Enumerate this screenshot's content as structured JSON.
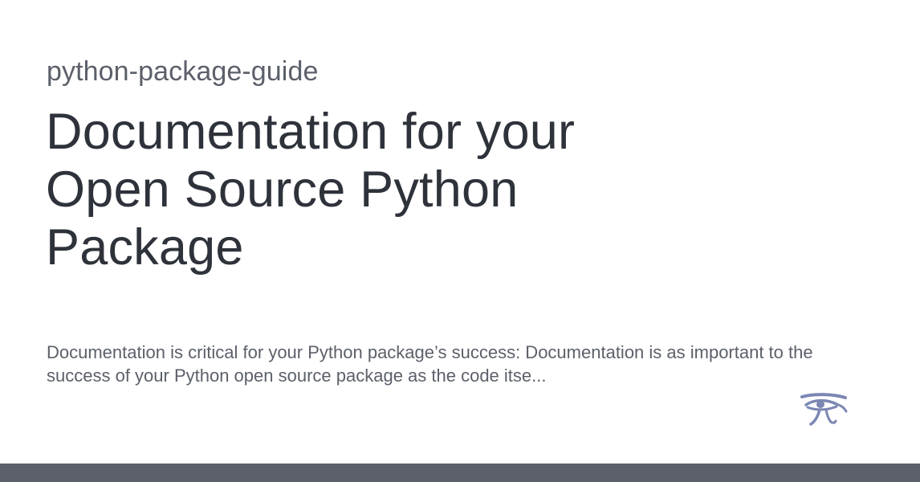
{
  "card": {
    "site_name": "python-package-guide",
    "title": "Documentation for your Open Source Python Package",
    "description": "Documentation is critical for your Python package’s success: Documentation is as important to the success of your Python open source package as the code itse...",
    "logo_icon": "eye-of-horus-icon",
    "colors": {
      "background": "#ffffff",
      "title": "#2e323a",
      "muted_text": "#5b606a",
      "logo": "#7b87b3",
      "bottom_bar": "#5b606a"
    }
  }
}
